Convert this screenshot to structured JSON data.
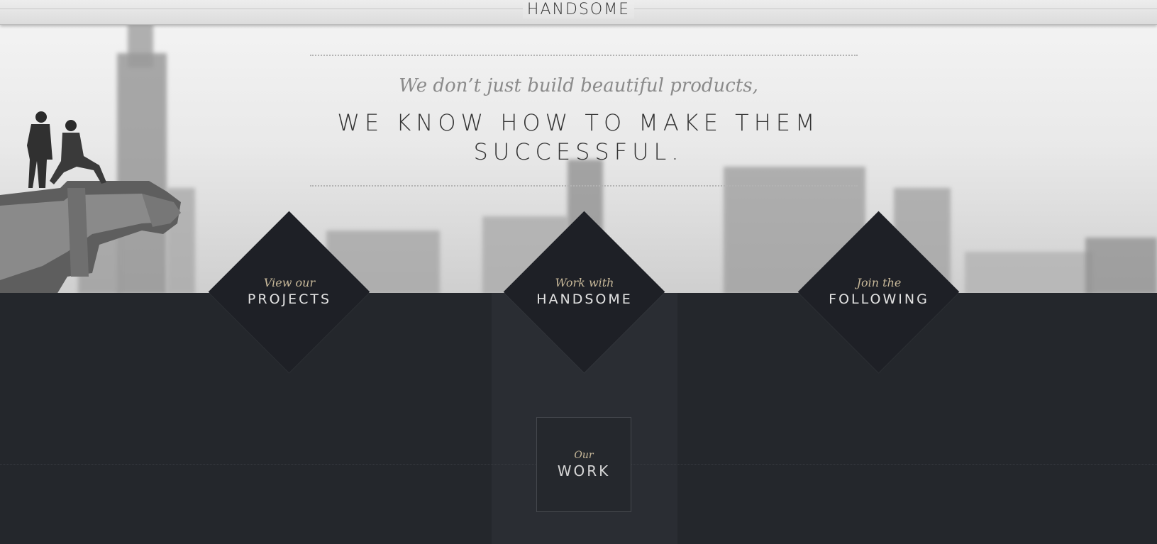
{
  "header": {
    "logo_text": "HANDSOME"
  },
  "hero": {
    "tagline": "We don’t just build beautiful products,",
    "headline_line1": "WE KNOW HOW TO MAKE THEM",
    "headline_line2": "SUCCESSFUL."
  },
  "actions": [
    {
      "small": "View our",
      "big": "PROJECTS"
    },
    {
      "small": "Work with",
      "big": "HANDSOME"
    },
    {
      "small": "Join the",
      "big": "FOLLOWING"
    }
  ],
  "work_box": {
    "small": "Our",
    "big": "WORK"
  },
  "colors": {
    "dark_background": "#24272c",
    "diamond_fill": "#1e2026",
    "accent_gold": "#c8b99a",
    "headline_text": "#333333"
  }
}
